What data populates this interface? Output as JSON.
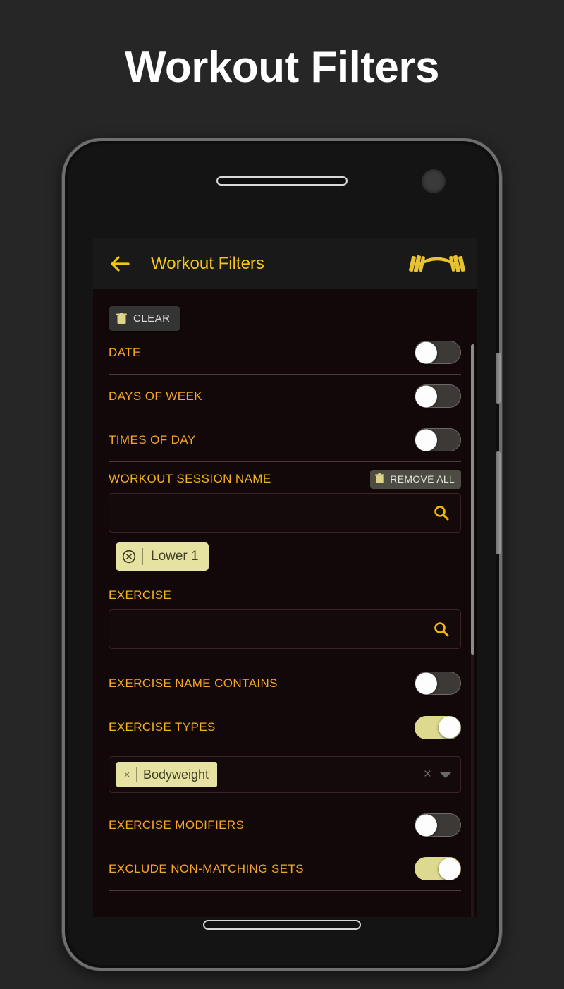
{
  "page": {
    "title": "Workout Filters"
  },
  "appbar": {
    "back_icon": "back-arrow-icon",
    "title": "Workout Filters",
    "right_icon": "barbell-icon"
  },
  "toolbar": {
    "clear_label": "CLEAR",
    "clear_icon": "trash-icon"
  },
  "filters": {
    "date": {
      "label": "DATE",
      "state": "off"
    },
    "days_of_week": {
      "label": "DAYS OF WEEK",
      "state": "off"
    },
    "times_of_day": {
      "label": "TIMES OF DAY",
      "state": "off"
    },
    "exercise_name_contains": {
      "label": "EXERCISE NAME CONTAINS",
      "state": "off"
    },
    "exercise_types": {
      "label": "EXERCISE TYPES",
      "state": "on"
    },
    "exercise_modifiers": {
      "label": "EXERCISE MODIFIERS",
      "state": "off"
    },
    "exclude_non_matching_sets": {
      "label": "EXCLUDE NON-MATCHING SETS",
      "state": "on"
    }
  },
  "workout_session_name": {
    "label": "WORKOUT SESSION NAME",
    "remove_all_label": "REMOVE ALL",
    "remove_all_icon": "trash-icon",
    "search_value": "",
    "search_placeholder": "",
    "search_icon": "search-icon",
    "chips": [
      {
        "text": "Lower 1",
        "remove_icon": "circle-x-icon"
      }
    ]
  },
  "exercise": {
    "label": "EXERCISE",
    "search_value": "",
    "search_placeholder": "",
    "search_icon": "search-icon"
  },
  "exercise_types_select": {
    "chips": [
      {
        "text": "Bodyweight",
        "remove_icon": "x-icon"
      }
    ],
    "clear_icon": "clear-x-icon",
    "dropdown_icon": "chevron-down-icon"
  },
  "colors": {
    "background": "#262626",
    "screen_background": "#120809",
    "appbar_background": "#191919",
    "accent_gold": "#f5c518",
    "label_gold": "#f3b31c",
    "label_orange": "#f5a623",
    "toggle_on_track": "#ddd98e",
    "chip_background": "#e6e2a2"
  }
}
